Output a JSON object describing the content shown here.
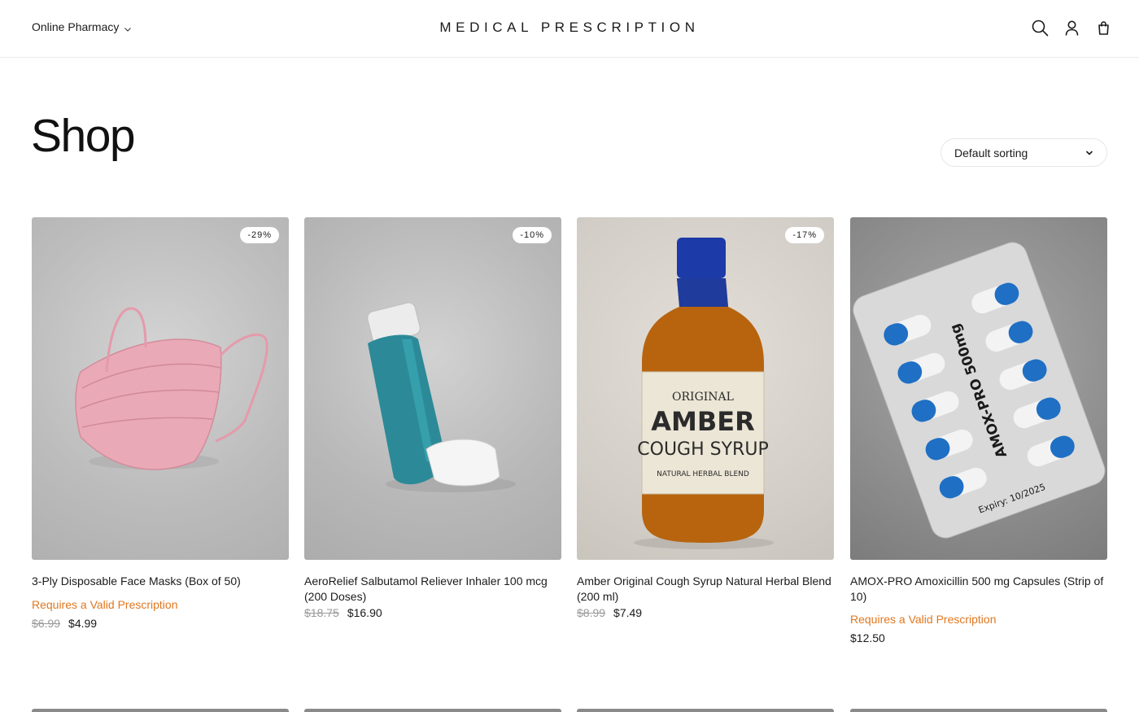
{
  "header": {
    "menu_label": "Online Pharmacy",
    "brand": "MEDICAL PRESCRIPTION",
    "icons": [
      "search-icon",
      "account-icon",
      "cart-icon"
    ]
  },
  "page": {
    "title": "Shop"
  },
  "sorting": {
    "selected": "Default sorting"
  },
  "colors": {
    "prescription_text": "#e0771f",
    "old_price": "#9a9a9a"
  },
  "products": [
    {
      "title": "3-Ply Disposable Face Masks (Box of 50)",
      "badge": "-29%",
      "prescription": "Requires a Valid Prescription",
      "old_price": "$6.99",
      "price": "$4.99"
    },
    {
      "title": "AeroRelief Salbutamol Reliever Inhaler 100 mcg (200 Doses)",
      "badge": "-10%",
      "old_price": "$18.75",
      "price": "$16.90"
    },
    {
      "title": "Amber Original Cough Syrup Natural Herbal Blend (200 ml)",
      "badge": "-17%",
      "old_price": "$8.99",
      "price": "$7.49",
      "label": {
        "line1": "ORIGINAL",
        "line2": "AMBER",
        "line3": "COUGH SYRUP",
        "line4": "NATURAL HERBAL BLEND"
      }
    },
    {
      "title": "AMOX-PRO Amoxicillin 500 mg Capsules (Strip of 10)",
      "prescription": "Requires a Valid Prescription",
      "price": "$12.50",
      "blister": {
        "brand": "AMOX-PRO 500mg",
        "expiry": "Expiry: 10/2025"
      }
    }
  ]
}
